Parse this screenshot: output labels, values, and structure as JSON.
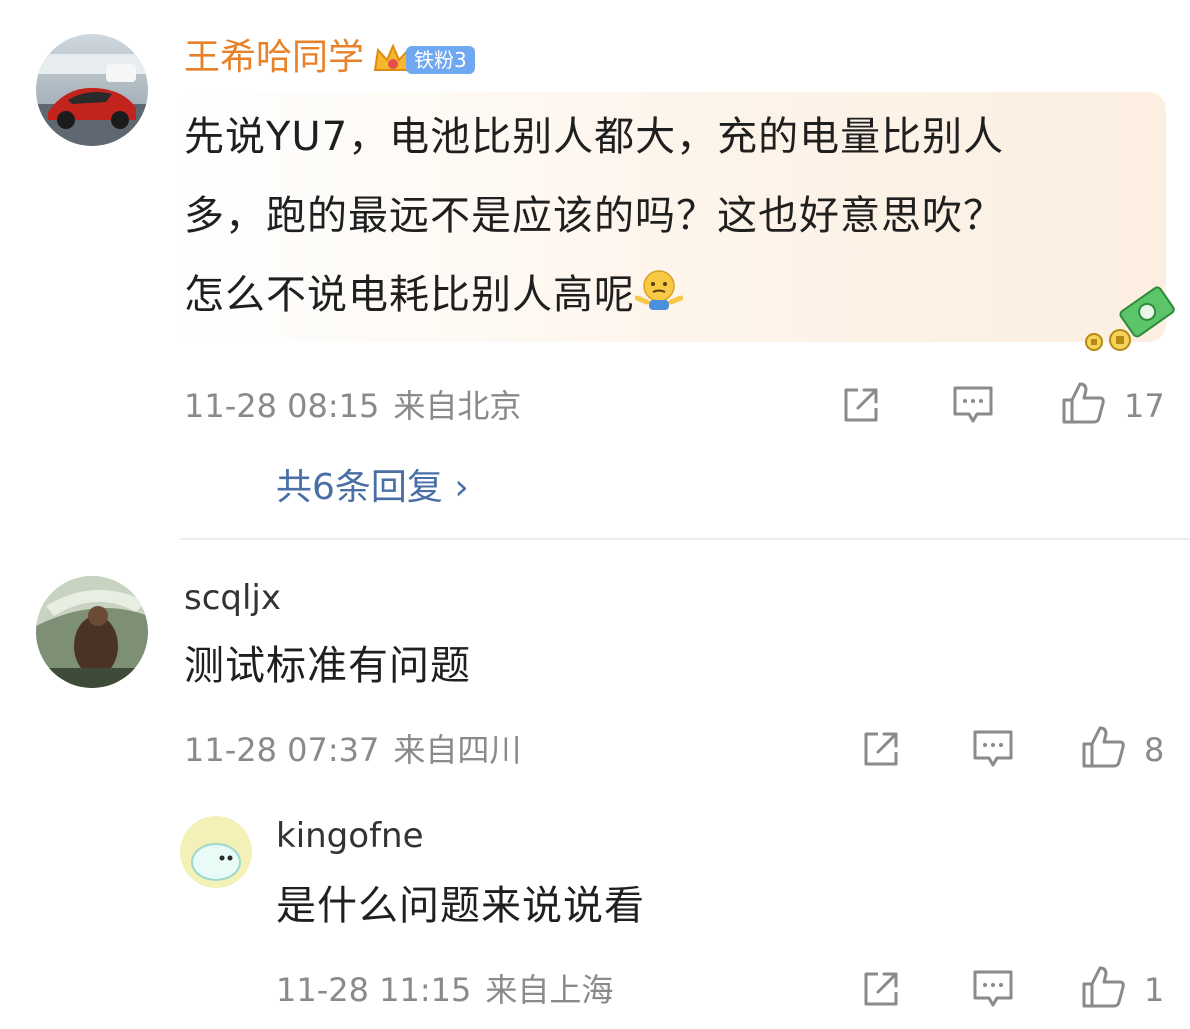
{
  "comments": [
    {
      "username": "王希哈同学",
      "fan_badge": "铁粉3",
      "text_lines": [
        "先说YU7，电池比别人都大，充的电量比别人",
        "多，跑的最远不是应该的吗？这也好意思吹？",
        "怎么不说电耗比别人高呢"
      ],
      "time": "11-28 08:15",
      "location": "来自北京",
      "likes": "17",
      "replies_link": "共6条回复 ›"
    },
    {
      "username": "scqljx",
      "text": "测试标准有问题",
      "time": "11-28 07:37",
      "location": "来自四川",
      "likes": "8"
    },
    {
      "username": "kingofne",
      "text": "是什么问题来说说看",
      "time": "11-28 11:15",
      "location": "来自上海",
      "likes": "1"
    }
  ],
  "icons": {
    "share": "share-icon",
    "comment": "comment-icon",
    "like": "thumbs-up-icon",
    "emoji": "shrug-emoji-icon",
    "sticker": "money-sticker-icon"
  },
  "colors": {
    "username_highlight": "#e8822a",
    "link_blue": "#4a6fa5",
    "meta_gray": "#8a8a8a",
    "badge_blue": "#6fa8f0"
  }
}
